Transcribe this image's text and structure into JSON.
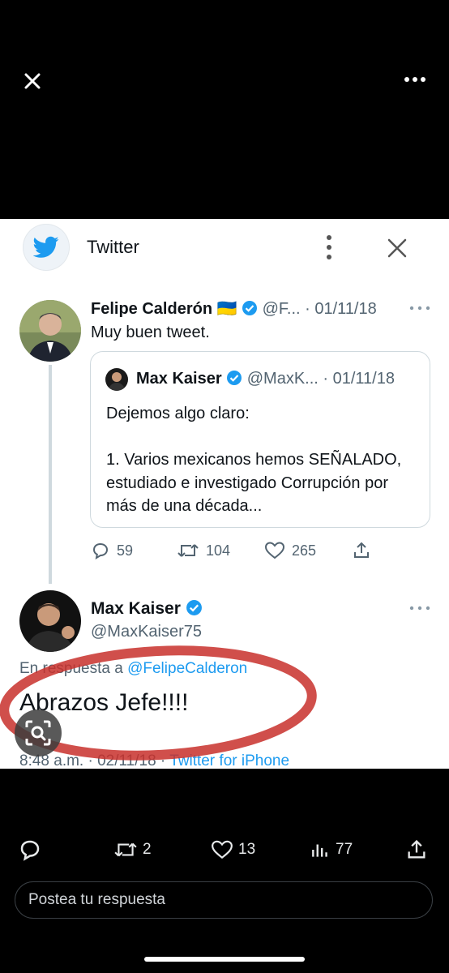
{
  "colors": {
    "accent": "#1d9bf0",
    "ring": "#c8302b",
    "verified": "#1d9bf0"
  },
  "viewer": {
    "close_icon": "close-icon",
    "more_icon": "more-horizontal-icon"
  },
  "embed": {
    "app_title": "Twitter",
    "tweet1": {
      "name": "Felipe Calderón",
      "flag": "🇺🇦",
      "handle_date": "@F... · 01/11/18",
      "text": "Muy buen tweet.",
      "quote": {
        "name": "Max Kaiser",
        "handle_date": "@MaxK... · 01/11/18",
        "text": "Dejemos algo claro:\n\n1. Varios mexicanos hemos SEÑALADO, estudiado e investigado Corrupción por más de una década..."
      },
      "replies": "59",
      "retweets": "104",
      "likes": "265"
    },
    "tweet2": {
      "name": "Max Kaiser",
      "handle": "@MaxKaiser75",
      "reply_prefix": "En respuesta a ",
      "reply_to": "@FelipeCalderon",
      "text": "Abrazos Jefe!!!!",
      "date": "8:48 a.m. · 02/11/18 · ",
      "source": "Twitter for iPhone"
    }
  },
  "bottom_bar": {
    "retweets": "2",
    "likes": "13",
    "views": "77"
  },
  "reply_box": {
    "placeholder": "Postea tu respuesta"
  }
}
